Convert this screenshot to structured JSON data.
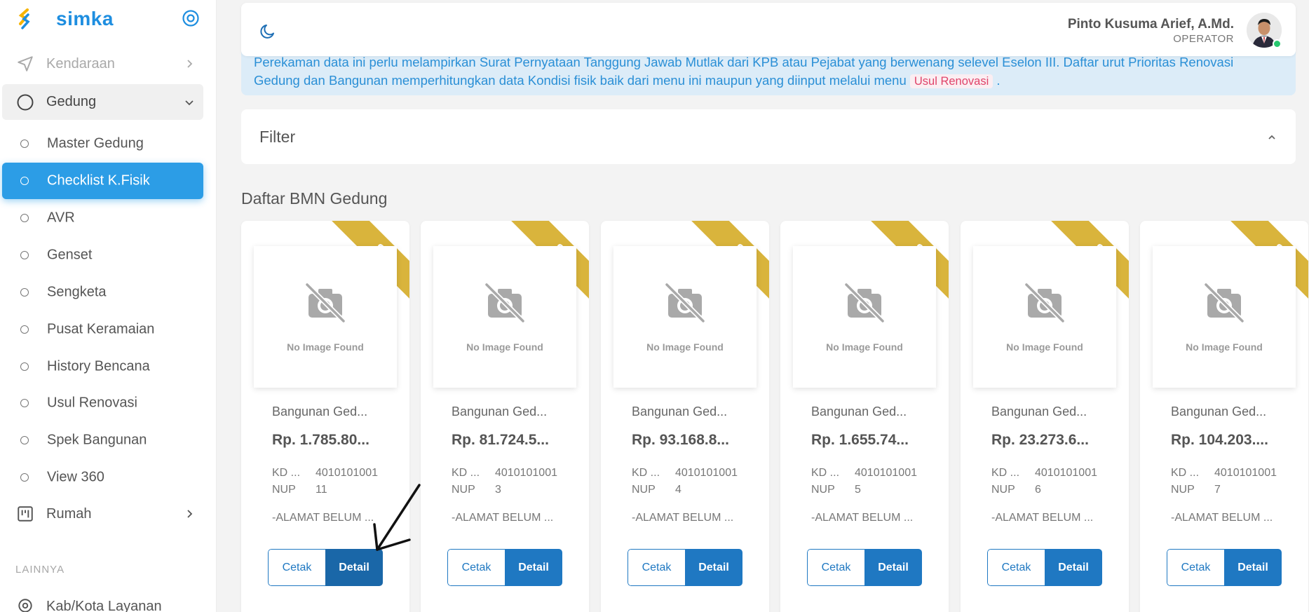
{
  "brand": {
    "name": "simka"
  },
  "sidebar": {
    "kendaraan": "Kendaraan",
    "gedung": "Gedung",
    "items": [
      {
        "label": "Master Gedung",
        "active": false
      },
      {
        "label": "Checklist K.Fisik",
        "active": true
      },
      {
        "label": "AVR",
        "active": false
      },
      {
        "label": "Genset",
        "active": false
      },
      {
        "label": "Sengketa",
        "active": false
      },
      {
        "label": "Pusat Keramaian",
        "active": false
      },
      {
        "label": "History Bencana",
        "active": false
      },
      {
        "label": "Usul Renovasi",
        "active": false
      },
      {
        "label": "Spek Bangunan",
        "active": false
      },
      {
        "label": "View 360",
        "active": false
      }
    ],
    "rumah": "Rumah",
    "section_label": "LAINNYA",
    "kabkota": "Kab/Kota Layanan"
  },
  "header": {
    "user_name": "Pinto Kusuma Arief, A.Md.",
    "user_role": "OPERATOR"
  },
  "info": {
    "text_1": "Perekaman data ini perlu melampirkan Surat Pernyataan Tanggung Jawab Mutlak dari KPB atau Pejabat yang berwenang selevel Eselon III. Daftar urut Prioritas Renovasi Gedung dan Bangunan memperhitungkan data Kondisi fisik baik dari menu ini maupun yang diinput melalui menu",
    "code": "Usul Renovasi",
    "text_2": "."
  },
  "filter": {
    "title": "Filter"
  },
  "list": {
    "title": "Daftar BMN Gedung"
  },
  "cards": [
    {
      "ribbon": "S",
      "no_image": "No Image Found",
      "title": "Bangunan Ged...",
      "price": "Rp. 1.785.80...",
      "kd_label": "KD ...",
      "kd_value": "4010101001",
      "nup_label": "NUP",
      "nup_value": "11",
      "address": "-ALAMAT BELUM ...",
      "cetak": "Cetak",
      "detail": "Detail"
    },
    {
      "ribbon": "S",
      "no_image": "No Image Found",
      "title": "Bangunan Ged...",
      "price": "Rp. 81.724.5...",
      "kd_label": "KD ...",
      "kd_value": "4010101001",
      "nup_label": "NUP",
      "nup_value": "3",
      "address": "-ALAMAT BELUM ...",
      "cetak": "Cetak",
      "detail": "Detail"
    },
    {
      "ribbon": "S",
      "no_image": "No Image Found",
      "title": "Bangunan Ged...",
      "price": "Rp. 93.168.8...",
      "kd_label": "KD ...",
      "kd_value": "4010101001",
      "nup_label": "NUP",
      "nup_value": "4",
      "address": "-ALAMAT BELUM ...",
      "cetak": "Cetak",
      "detail": "Detail"
    },
    {
      "ribbon": "S",
      "no_image": "No Image Found",
      "title": "Bangunan Ged...",
      "price": "Rp. 1.655.74...",
      "kd_label": "KD ...",
      "kd_value": "4010101001",
      "nup_label": "NUP",
      "nup_value": "5",
      "address": "-ALAMAT BELUM ...",
      "cetak": "Cetak",
      "detail": "Detail"
    },
    {
      "ribbon": "S",
      "no_image": "No Image Found",
      "title": "Bangunan Ged...",
      "price": "Rp. 23.273.6...",
      "kd_label": "KD ...",
      "kd_value": "4010101001",
      "nup_label": "NUP",
      "nup_value": "6",
      "address": "-ALAMAT BELUM ...",
      "cetak": "Cetak",
      "detail": "Detail"
    },
    {
      "ribbon": "S",
      "no_image": "No Image Found",
      "title": "Bangunan Ged...",
      "price": "Rp. 104.203....",
      "kd_label": "KD ...",
      "kd_value": "4010101001",
      "nup_label": "NUP",
      "nup_value": "7",
      "address": "-ALAMAT BELUM ...",
      "cetak": "Cetak",
      "detail": "Detail"
    }
  ],
  "colors": {
    "primary": "#1f78c2",
    "active_nav": "#2c9de6",
    "ribbon": "#d9b43c",
    "info_bg": "#dcecf8"
  },
  "icons": {
    "collapse": "target-circle-icon",
    "kendaraan": "send-icon",
    "gedung": "circle-icon",
    "rumah": "layout-icon",
    "kabkota": "map-pin-icon",
    "theme": "moon-icon",
    "no_image": "camera-off-icon"
  }
}
